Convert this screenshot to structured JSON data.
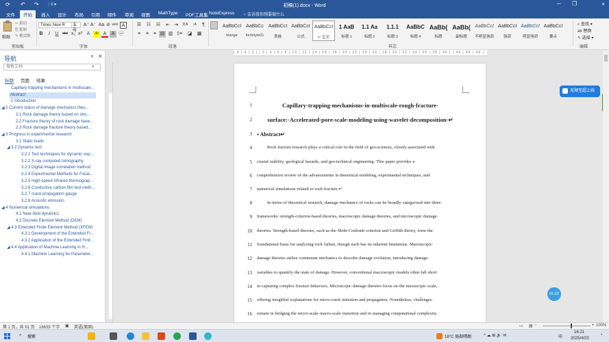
{
  "titlebar": {
    "title": "初稿(1).docx - Word",
    "undo": "↶",
    "redo": "↷",
    "autosave": "⟳",
    "more": "⋮≡ ▾",
    "minimize": "─",
    "maximize": "❐",
    "close": "✕"
  },
  "menu": {
    "tabs": [
      "文件",
      "开始",
      "插入",
      "设计",
      "布局",
      "引用",
      "邮件",
      "审阅",
      "视图",
      "MathType",
      "PDF工具集",
      "NoteExpress"
    ],
    "tell_me": "♀ 告诉我你想要做什么"
  },
  "ribbon": {
    "clipboard": {
      "paste": "粘贴",
      "cut": "✂ 剪切",
      "copy": "⎘ 复制",
      "format_painter": "✎ 格式刷",
      "group": "剪贴板"
    },
    "font": {
      "name": "Times New R",
      "size": "五号",
      "group": "字体",
      "row1": [
        "A⁺",
        "A⁻",
        "Aa",
        "⊘",
        "wén",
        "A"
      ],
      "row2": [
        "B",
        "I",
        "U",
        "abc",
        "x₂",
        "x²",
        "A",
        "ab",
        "A",
        "A",
        "㊀"
      ]
    },
    "paragraph": {
      "group": "段落",
      "row1": [
        "☰",
        "☷",
        "☵",
        "⇤",
        "⇥",
        "文A",
        "↕A",
        "¶"
      ],
      "row2": [
        "≡",
        "≡",
        "≡",
        "▤",
        "▥",
        "‡≡",
        "◪",
        "▦"
      ]
    },
    "styles": {
      "group": "样式",
      "items": [
        {
          "preview": "AaBbCcI",
          "name": "biaoge"
        },
        {
          "preview": "AaBbCc",
          "name": "fontstyle01"
        },
        {
          "preview": "AaBbCcI",
          "name": "表格"
        },
        {
          "preview": "AaBbCcI",
          "name": "公式"
        },
        {
          "preview": "AaBbCcI",
          "name": "↵ 正文"
        },
        {
          "preview": "1 AaB",
          "name": "标题 1"
        },
        {
          "preview": "1.1 Aa",
          "name": "标题 2"
        },
        {
          "preview": "1.1.1",
          "name": "标题 3"
        },
        {
          "preview": "AaBbC",
          "name": "标题 4"
        },
        {
          "preview": "AaBb(",
          "name": "标题"
        },
        {
          "preview": "AaBb(",
          "name": "副标题"
        },
        {
          "preview": "AaBbCcI",
          "name": "不明显强调"
        },
        {
          "preview": "AaBbCcI",
          "name": "强调"
        },
        {
          "preview": "AaBbCcI",
          "name": "明显强调"
        },
        {
          "preview": "AaBbCcI",
          "name": "要点"
        }
      ]
    },
    "editing": {
      "group": "编辑",
      "find": "⌕ 查找 ▾",
      "replace": "ab 替换",
      "select": "↖ 选择 ▾"
    }
  },
  "nav": {
    "title": "导航",
    "search_placeholder": "搜索文档",
    "search_icon": "⌕",
    "tabs": [
      "标题",
      "页面",
      "结果"
    ],
    "items": [
      {
        "text": "Capillary trapping mechanisms in multiscale...",
        "level": 1,
        "selected": false
      },
      {
        "text": "Abstract",
        "level": 1,
        "selected": true
      },
      {
        "text": "1 Introduction",
        "level": 1,
        "selected": false
      },
      {
        "text": "◢ 2 Current status of damage mechanics theo...",
        "level": 0,
        "selected": false
      },
      {
        "text": "2.1 Rock damage theory based on stre...",
        "level": 2,
        "selected": false
      },
      {
        "text": "2.2 Fracture theory of rock damage base...",
        "level": 2,
        "selected": false
      },
      {
        "text": "2.3 Rock damage fracture theory based...",
        "level": 2,
        "selected": false
      },
      {
        "text": "◢ 3 Progress in experimental research",
        "level": 0,
        "selected": false
      },
      {
        "text": "3.1 Static loads",
        "level": 2,
        "selected": false
      },
      {
        "text": "◢ 3.2 Dynamic test",
        "level": 1,
        "selected": false
      },
      {
        "text": "3.2.1 Test techniques for dynamic exp...",
        "level": 3,
        "selected": false
      },
      {
        "text": "3.2.2 X-ray computed tomography",
        "level": 3,
        "selected": false
      },
      {
        "text": "3.2.3 Digital image correlation method",
        "level": 3,
        "selected": false
      },
      {
        "text": "3.2.4 Experimental Methods for Focal...",
        "level": 3,
        "selected": false
      },
      {
        "text": "3.2.5 High-speed infrared thermograp...",
        "level": 3,
        "selected": false
      },
      {
        "text": "3.2.6 Conductive carbon film test meth...",
        "level": 3,
        "selected": false
      },
      {
        "text": "3.2.7 crack propagation gauge",
        "level": 3,
        "selected": false
      },
      {
        "text": "3.2.8 Acoustic emission",
        "level": 3,
        "selected": false
      },
      {
        "text": "◢ 4 Numerical simulations",
        "level": 0,
        "selected": false
      },
      {
        "text": "4.1 Near-field dynamics",
        "level": 2,
        "selected": false
      },
      {
        "text": "4.2 Discrete Element Method (DEM)",
        "level": 2,
        "selected": false
      },
      {
        "text": "◢ 4.3 Extended Finite Element Method (XFEM)",
        "level": 1,
        "selected": false
      },
      {
        "text": "4.3.1 Development of the Extended Fi...",
        "level": 3,
        "selected": false
      },
      {
        "text": "4.3.2 Application of the Extended Finit...",
        "level": 3,
        "selected": false
      },
      {
        "text": "◢ 4.4 Application of Machine Learning in H...",
        "level": 1,
        "selected": false
      },
      {
        "text": "4.4.1 Machine Learning for Parameter...",
        "level": 3,
        "selected": false
      }
    ]
  },
  "ruler": {
    "ticks": "| 6 | 4 | 2 |   | 2 | 4 | 6 | 8 | 10 | 12 | 14 | 16 | 18 | 20 | 22 | 24 | 26 | 28 | 30 | 32 | 34 | 36 | 38 | 40 |  | 44 | 46 | 48 |"
  },
  "document": {
    "lines": [
      {
        "num": "1",
        "text": "Capillary·trapping·mechanisms·in·multiscale·rough·fracture·",
        "style": "title"
      },
      {
        "num": "2",
        "text": "surface:·Accelerated·pore-scale·modeling·using·wavelet·decomposition·↵",
        "style": "title"
      },
      {
        "num": "3",
        "text": "▪ Abstract↵",
        "style": "head"
      },
      {
        "num": "4",
        "text": "Rock·fracture·research·plays·a·critical·role·in·the·field·of·geo-sciences,·closely·associated·with·",
        "style": "indent"
      },
      {
        "num": "5",
        "text": "crustal·stability,·geological·hazards,·and·geo-technical·engineering.·This·paper·provides·a·",
        "style": "body"
      },
      {
        "num": "6",
        "text": "comprehensive·review·of·the·advancements·in·theoretical·modeling,·experimental·techniques,·and·",
        "style": "body"
      },
      {
        "num": "7",
        "text": "numerical·simulations·related·to·rock·fracture.↵",
        "style": "last"
      },
      {
        "num": "8",
        "text": "In·terms·of·theoretical·research,·damage·mechanics·of·rocks·can·be·broadly·categorized·into·three·",
        "style": "indent"
      },
      {
        "num": "9",
        "text": "frameworks:·strength-criterion-based·theories,·macroscopic·damage·theories,·and·microscopic·damage·",
        "style": "body"
      },
      {
        "num": "10",
        "text": "theories.·Strength-based·theories,·such·as·the·Mohr-Coulomb·criterion·and·Griffith·theory,·form·the·",
        "style": "body"
      },
      {
        "num": "11",
        "text": "foundational·basis·for·analyzing·rock·failure,·though·each·has·its·inherent·limitations.·Macroscopic·",
        "style": "body"
      },
      {
        "num": "12",
        "text": "damage·theories·utilize·continuum·mechanics·to·describe·damage·evolution,·introducing·damage·",
        "style": "body"
      },
      {
        "num": "13",
        "text": "variables·to·quantify·the·state·of·damage.·However,·conventional·macroscopic·models·often·fall·short·",
        "style": "body"
      },
      {
        "num": "14",
        "text": "in·capturing·complex·fracture·behaviors.·Microscopic·damage·theories·focus·on·the·mesoscopic·scale,·",
        "style": "body"
      },
      {
        "num": "15",
        "text": "offering·insightful·explanations·for·micro-crack·initiation·and·propagation.·Nonetheless,·challenges·",
        "style": "body"
      },
      {
        "num": "16",
        "text": "remain·in·bridging·the·micro-scale–macro-scale·transition·and·in·managing·computational·complexity.·",
        "style": "body"
      }
    ]
  },
  "overlays": {
    "translate": "无限至超上线",
    "time": "01:32"
  },
  "status": {
    "page": "第 1 页，共 61 页",
    "words": "18639 个字",
    "lang": "英语(美国)",
    "zoom": "100%",
    "zoom_minus": "−",
    "zoom_plus": "+"
  },
  "taskbar": {
    "search": "搜索",
    "weather": "18°C 局部晴朗",
    "time": "16:21",
    "date": "2025/4/23",
    "ime": "中",
    "tray": "^ ☁ ⊞ 🔊 ✉"
  },
  "colors": {
    "accent": "#2b579a",
    "selected_nav": "#cfe1f6"
  }
}
